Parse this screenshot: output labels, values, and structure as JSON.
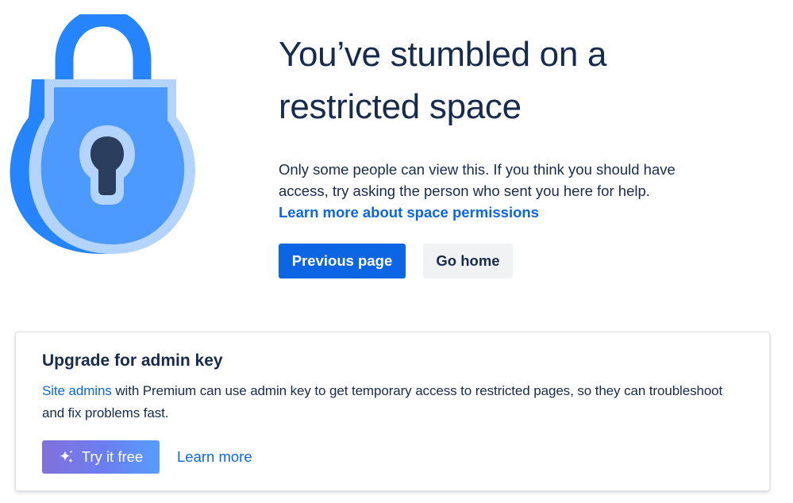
{
  "hero": {
    "headline": "You’ve stumbled on a restricted space",
    "description": "Only some people can view this. If you think you should have access, try asking the person who sent you here for help.",
    "permissions_link": "Learn more about space permissions",
    "illustration_icon": "padlock-icon",
    "primary_button": "Previous page",
    "secondary_button": "Go home"
  },
  "upgrade_card": {
    "title": "Upgrade for admin key",
    "body_link": "Site admins",
    "body_text": " with Premium can use admin key to get temporary access to restricted pages, so they can troubleshoot and fix problems fast.",
    "try_button": "Try it free",
    "try_button_icon": "sparkle-icon",
    "learn_more": "Learn more"
  },
  "colors": {
    "text": "#172B4D",
    "link": "#0C66E4",
    "primary_button_bg": "#0C66E4",
    "secondary_button_bg": "#F1F2F4",
    "lock_body": "#4C9AFF",
    "lock_outline": "#B3D4FF",
    "lock_keyhole": "#2C3E5D",
    "try_gradient_start": "#8270DB",
    "try_gradient_end": "#579DFF"
  }
}
